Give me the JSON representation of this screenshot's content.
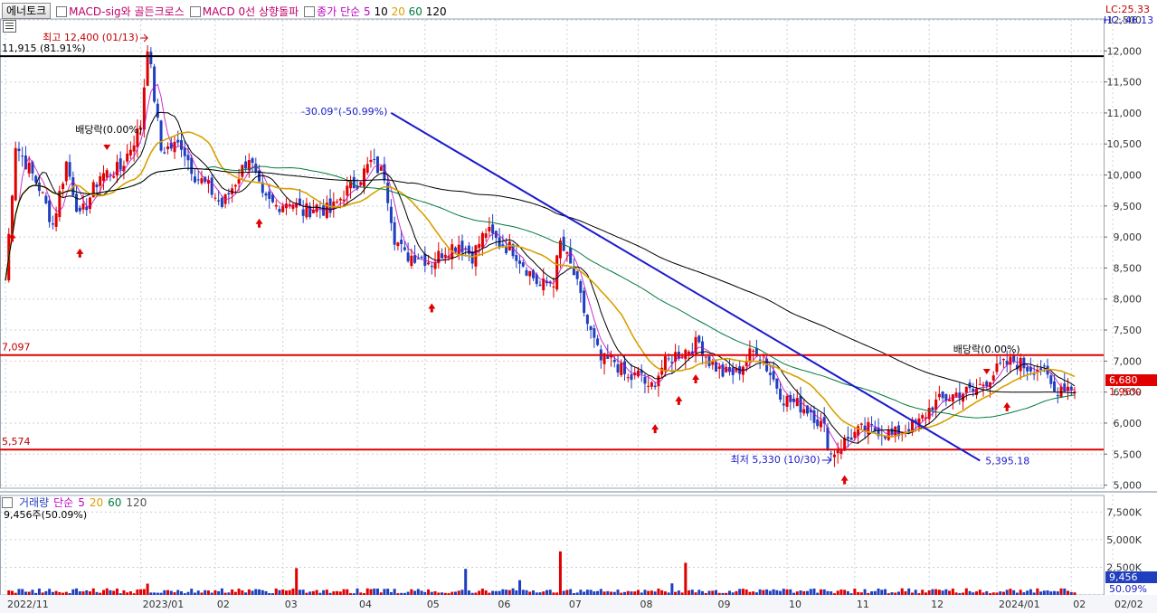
{
  "header": {
    "stock_name": "에너토크",
    "indicators": [
      {
        "label": "MACD-sig와 골든크로스",
        "color": "#c0006a"
      },
      {
        "label": "MACD 0선 상향돌파",
        "color": "#c0006a"
      }
    ],
    "ma_label": "종가 단순",
    "ma_periods": [
      {
        "label": "5",
        "color": "#c000c0"
      },
      {
        "label": "10",
        "color": "#000000"
      },
      {
        "label": "20",
        "color": "#d8a000"
      },
      {
        "label": "60",
        "color": "#007a3d"
      },
      {
        "label": "120",
        "color": "#000000"
      }
    ]
  },
  "right_info": {
    "lc": "LC:25.33",
    "hc": "HC:-46.13"
  },
  "current": {
    "price_label": "6,680",
    "change_label": "1.96%",
    "color": "#e00000"
  },
  "volume_panel": {
    "title": "거래량",
    "ma_label": "단순",
    "ma_periods": [
      {
        "label": "5",
        "color": "#c000c0"
      },
      {
        "label": "20",
        "color": "#d8a000"
      },
      {
        "label": "60",
        "color": "#007a3d"
      },
      {
        "label": "120",
        "color": "#555555"
      }
    ],
    "current_label": "9,456주(50.09%)",
    "axis_current": "9,456",
    "axis_pct": "50.09%"
  },
  "annotations": {
    "high": "최고 12,400 (01/13)",
    "low": "최저 5,330 (10/30)",
    "trend_start": "-30.09°(-50.99%)",
    "trend_end": "5,395.18",
    "dividend1": "배당락(0.00%)",
    "dividend2": "배당락(0.00%)"
  },
  "levels": [
    {
      "label": "11,915 (81.91%)",
      "value": 11915,
      "color": "#000000"
    },
    {
      "label": "7,097",
      "value": 7097,
      "color": "#e00000"
    },
    {
      "label": "5,574",
      "value": 5574,
      "color": "#e00000"
    }
  ],
  "colors": {
    "up": "#e00000",
    "down": "#1f3fbf",
    "trend": "#1a1acc",
    "grid": "#c8d0dc"
  },
  "chart_data": {
    "type": "candlestick",
    "price_axis": {
      "min": 5000,
      "max": 12500,
      "ticks": [
        5000,
        5500,
        6000,
        6500,
        7000,
        7500,
        8000,
        8500,
        9000,
        9500,
        10000,
        10500,
        11000,
        11500,
        12000,
        12500
      ],
      "tick_labels": [
        "5,000",
        "5,500",
        "6,000",
        "6,500",
        "7,000",
        "7,500",
        "8,000",
        "8,500",
        "9,000",
        "9,500",
        "10,000",
        "10,500",
        "11,000",
        "11,500",
        "12,000",
        "12,500"
      ]
    },
    "volume_axis": {
      "ticks": [
        0,
        2500,
        5000,
        7500
      ],
      "tick_labels": [
        "0",
        "2,500K",
        "5,000K",
        "7,500K"
      ]
    },
    "x_labels": [
      {
        "label": "2022/11",
        "pos": 0
      },
      {
        "label": "2023/01",
        "pos": 40
      },
      {
        "label": "02",
        "pos": 62
      },
      {
        "label": "03",
        "pos": 82
      },
      {
        "label": "04",
        "pos": 104
      },
      {
        "label": "05",
        "pos": 124
      },
      {
        "label": "06",
        "pos": 145
      },
      {
        "label": "07",
        "pos": 166
      },
      {
        "label": "08",
        "pos": 187
      },
      {
        "label": "09",
        "pos": 210
      },
      {
        "label": "10",
        "pos": 231
      },
      {
        "label": "11",
        "pos": 251
      },
      {
        "label": "12",
        "pos": 273
      },
      {
        "label": "2024/01",
        "pos": 293
      },
      {
        "label": "02",
        "pos": 315
      },
      {
        "label": "02/02",
        "pos": 340
      }
    ],
    "price_keypoints": [
      [
        0,
        8300
      ],
      [
        3,
        10500
      ],
      [
        6,
        10200
      ],
      [
        10,
        9800
      ],
      [
        14,
        9200
      ],
      [
        18,
        10200
      ],
      [
        22,
        9300
      ],
      [
        28,
        10000
      ],
      [
        34,
        10100
      ],
      [
        40,
        10800
      ],
      [
        42,
        12100
      ],
      [
        46,
        10400
      ],
      [
        52,
        10500
      ],
      [
        56,
        10000
      ],
      [
        60,
        9800
      ],
      [
        64,
        9500
      ],
      [
        68,
        9900
      ],
      [
        72,
        10300
      ],
      [
        76,
        9600
      ],
      [
        80,
        9500
      ],
      [
        84,
        9600
      ],
      [
        88,
        9400
      ],
      [
        92,
        9500
      ],
      [
        96,
        9400
      ],
      [
        100,
        9700
      ],
      [
        104,
        9900
      ],
      [
        108,
        10200
      ],
      [
        112,
        10000
      ],
      [
        115,
        9000
      ],
      [
        118,
        8700
      ],
      [
        122,
        8700
      ],
      [
        126,
        8600
      ],
      [
        130,
        8800
      ],
      [
        134,
        8900
      ],
      [
        138,
        8700
      ],
      [
        142,
        9100
      ],
      [
        146,
        8900
      ],
      [
        150,
        8800
      ],
      [
        154,
        8500
      ],
      [
        158,
        8200
      ],
      [
        162,
        8300
      ],
      [
        164,
        8900
      ],
      [
        168,
        8400
      ],
      [
        172,
        7600
      ],
      [
        176,
        7000
      ],
      [
        180,
        7000
      ],
      [
        184,
        6700
      ],
      [
        188,
        6800
      ],
      [
        190,
        6500
      ],
      [
        194,
        6900
      ],
      [
        198,
        7100
      ],
      [
        202,
        7200
      ],
      [
        205,
        7300
      ],
      [
        208,
        7000
      ],
      [
        212,
        6800
      ],
      [
        216,
        6800
      ],
      [
        220,
        7100
      ],
      [
        222,
        7200
      ],
      [
        226,
        6800
      ],
      [
        230,
        6400
      ],
      [
        234,
        6300
      ],
      [
        238,
        6200
      ],
      [
        242,
        5900
      ],
      [
        244,
        5500
      ],
      [
        246,
        5600
      ],
      [
        250,
        5800
      ],
      [
        254,
        5900
      ],
      [
        258,
        5900
      ],
      [
        262,
        5800
      ],
      [
        266,
        5900
      ],
      [
        270,
        6000
      ],
      [
        274,
        6300
      ],
      [
        278,
        6400
      ],
      [
        282,
        6500
      ],
      [
        286,
        6500
      ],
      [
        290,
        6700
      ],
      [
        294,
        6900
      ],
      [
        298,
        7000
      ],
      [
        302,
        6900
      ],
      [
        306,
        6900
      ],
      [
        310,
        6500
      ],
      [
        312,
        6600
      ]
    ],
    "high": 12400,
    "low": 5330,
    "trend_from": {
      "pos": 114,
      "price": 11000
    },
    "trend_to": {
      "pos": 288,
      "price": 5395.18
    },
    "ma_legend": [
      "5",
      "10",
      "20",
      "60",
      "120"
    ]
  }
}
